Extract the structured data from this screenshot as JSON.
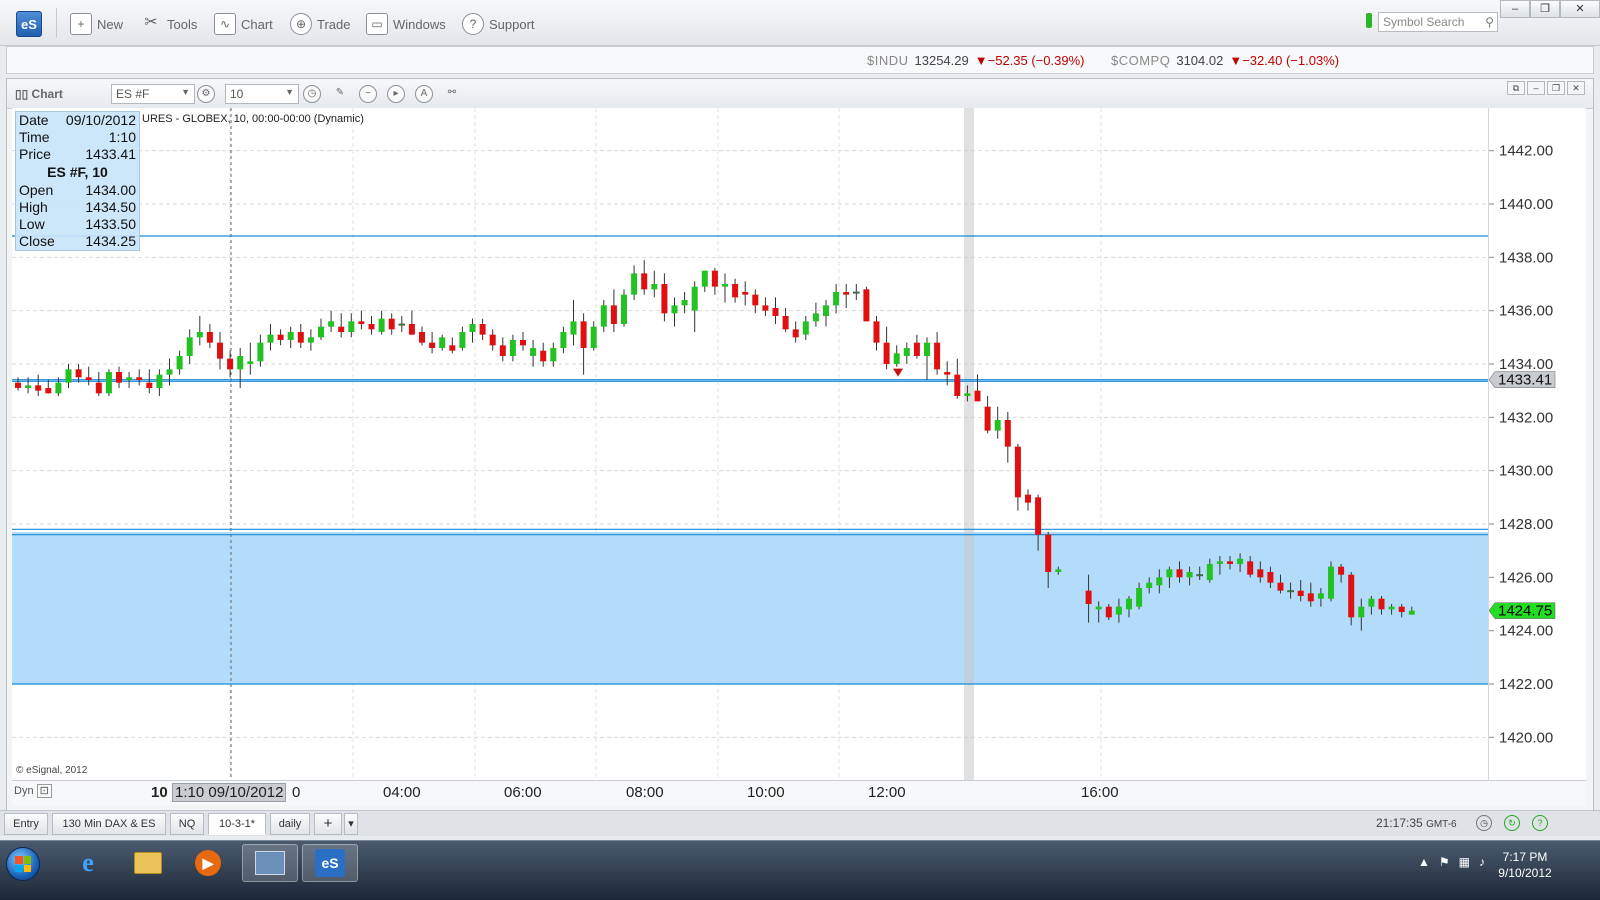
{
  "toolbar": {
    "logo": "eS",
    "items": [
      {
        "label": "New",
        "icon": "new-icon"
      },
      {
        "label": "Tools",
        "icon": "tools-icon"
      },
      {
        "label": "Chart",
        "icon": "chart-icon"
      },
      {
        "label": "Trade",
        "icon": "trade-icon"
      },
      {
        "label": "Windows",
        "icon": "windows-icon"
      },
      {
        "label": "Support",
        "icon": "help-icon"
      }
    ],
    "search_placeholder": "Symbol Search"
  },
  "ticker": [
    {
      "symbol": "$INDU",
      "value": "13254.29",
      "change": "▼−52.35 (−0.39%)"
    },
    {
      "symbol": "$COMPQ",
      "value": "3104.02",
      "change": "▼−32.40 (−1.03%)"
    }
  ],
  "chart_window": {
    "title": "Chart",
    "symbol": "ES #F",
    "interval": "10",
    "info": "URES - GLOBEX, 10, 00:00-00:00 (Dynamic)",
    "copyright": "© eSignal, 2012",
    "dyn_label": "Dyn"
  },
  "data_window": {
    "date_label": "Date",
    "date": "09/10/2012",
    "time_label": "Time",
    "time": "1:10",
    "price_label": "Price",
    "price": "1433.41",
    "title": "ES #F, 10",
    "open_label": "Open",
    "open": "1434.00",
    "high_label": "High",
    "high": "1434.50",
    "low_label": "Low",
    "low": "1433.50",
    "close_label": "Close",
    "close": "1434.25"
  },
  "x_labels": {
    "day": "10",
    "cursor": "1:10 09/10/2012",
    "partial": "0"
  },
  "tabs": [
    "Entry",
    "130 Min DAX & ES",
    "NQ",
    "10-3-1*",
    "daily"
  ],
  "tab_add": "+",
  "tab_menu": "▾",
  "status": {
    "time": "21:17:35",
    "tz": "GMT-6"
  },
  "taskbar": {
    "clock_time": "7:17 PM",
    "clock_date": "9/10/2012",
    "active_app": "eS"
  },
  "colors": {
    "up": "#22c222",
    "down": "#e01010",
    "zone": "#b3dcfa",
    "line": "#1a8ad8",
    "current_price": "#22dd22"
  },
  "chart_data": {
    "type": "candlestick",
    "ylim": [
      1418.4,
      1443.6
    ],
    "yticks": [
      "1442.00",
      "1440.00",
      "1438.00",
      "1436.00",
      "1434.00",
      "1432.00",
      "1430.00",
      "1428.00",
      "1426.00",
      "1424.00",
      "1422.00",
      "1420.00"
    ],
    "xticks": [
      "04:00",
      "06:00",
      "08:00",
      "10:00",
      "12:00",
      "16:00"
    ],
    "horizontal_lines": [
      1438.8,
      1433.41,
      1433.35,
      1427.8,
      1427.6,
      1422.0
    ],
    "zone": [
      1422.0,
      1427.7
    ],
    "cursor_price_label": "1433.41",
    "last_price_label": "1424.75",
    "last_price": 1424.75,
    "candles": [
      [
        1433.3,
        1433.5,
        1433.0,
        1433.1
      ],
      [
        1433.1,
        1433.5,
        1432.9,
        1433.2
      ],
      [
        1433.2,
        1433.6,
        1432.8,
        1433.0
      ],
      [
        1433.1,
        1433.4,
        1432.9,
        1432.9
      ],
      [
        1432.9,
        1433.5,
        1432.8,
        1433.3
      ],
      [
        1433.3,
        1434.0,
        1433.1,
        1433.8
      ],
      [
        1433.8,
        1434.0,
        1433.3,
        1433.5
      ],
      [
        1433.5,
        1433.9,
        1433.2,
        1433.4
      ],
      [
        1433.3,
        1433.7,
        1432.8,
        1432.9
      ],
      [
        1432.9,
        1433.8,
        1432.8,
        1433.7
      ],
      [
        1433.7,
        1433.9,
        1433.1,
        1433.3
      ],
      [
        1433.4,
        1433.7,
        1433.1,
        1433.5
      ],
      [
        1433.5,
        1433.8,
        1433.2,
        1433.4
      ],
      [
        1433.3,
        1433.8,
        1432.9,
        1433.1
      ],
      [
        1433.1,
        1433.8,
        1432.8,
        1433.6
      ],
      [
        1433.6,
        1434.2,
        1433.2,
        1433.8
      ],
      [
        1433.8,
        1434.5,
        1433.6,
        1434.3
      ],
      [
        1434.3,
        1435.3,
        1434.0,
        1435.0
      ],
      [
        1435.0,
        1435.8,
        1434.7,
        1435.2
      ],
      [
        1435.2,
        1435.5,
        1434.6,
        1434.8
      ],
      [
        1434.8,
        1435.2,
        1433.8,
        1434.2
      ],
      [
        1434.2,
        1434.5,
        1433.5,
        1433.8
      ],
      [
        1433.8,
        1434.6,
        1433.1,
        1434.3
      ],
      [
        1434.0,
        1434.8,
        1433.6,
        1434.1
      ],
      [
        1434.1,
        1435.1,
        1433.9,
        1434.8
      ],
      [
        1434.8,
        1435.5,
        1434.5,
        1435.1
      ],
      [
        1435.1,
        1435.3,
        1434.7,
        1434.9
      ],
      [
        1434.9,
        1435.4,
        1434.6,
        1435.2
      ],
      [
        1435.2,
        1435.5,
        1434.6,
        1434.8
      ],
      [
        1434.8,
        1435.3,
        1434.5,
        1435.0
      ],
      [
        1435.0,
        1435.7,
        1434.9,
        1435.4
      ],
      [
        1435.4,
        1436.0,
        1435.2,
        1435.6
      ],
      [
        1435.4,
        1435.9,
        1435.0,
        1435.2
      ],
      [
        1435.2,
        1435.9,
        1435.0,
        1435.6
      ],
      [
        1435.6,
        1436.0,
        1435.3,
        1435.5
      ],
      [
        1435.5,
        1435.8,
        1435.1,
        1435.3
      ],
      [
        1435.2,
        1436.0,
        1435.1,
        1435.7
      ],
      [
        1435.7,
        1435.9,
        1435.1,
        1435.3
      ],
      [
        1435.5,
        1435.8,
        1435.2,
        1435.5
      ],
      [
        1435.5,
        1436.0,
        1435.1,
        1435.1
      ],
      [
        1435.2,
        1435.4,
        1434.7,
        1434.8
      ],
      [
        1434.8,
        1435.2,
        1434.4,
        1434.6
      ],
      [
        1434.6,
        1435.1,
        1434.5,
        1435.0
      ],
      [
        1434.7,
        1435.0,
        1434.4,
        1434.5
      ],
      [
        1434.6,
        1435.4,
        1434.5,
        1435.2
      ],
      [
        1435.2,
        1435.7,
        1434.8,
        1435.5
      ],
      [
        1435.5,
        1435.7,
        1434.9,
        1435.1
      ],
      [
        1435.1,
        1435.3,
        1434.5,
        1434.7
      ],
      [
        1434.7,
        1435.0,
        1434.1,
        1434.3
      ],
      [
        1434.3,
        1435.1,
        1434.1,
        1434.9
      ],
      [
        1434.9,
        1435.2,
        1434.5,
        1434.7
      ],
      [
        1434.3,
        1434.9,
        1433.9,
        1434.6
      ],
      [
        1434.5,
        1434.8,
        1433.9,
        1434.1
      ],
      [
        1434.1,
        1434.8,
        1433.9,
        1434.6
      ],
      [
        1434.6,
        1435.4,
        1434.4,
        1435.2
      ],
      [
        1435.1,
        1436.4,
        1434.7,
        1435.6
      ],
      [
        1435.6,
        1435.9,
        1433.6,
        1434.6
      ],
      [
        1434.6,
        1435.6,
        1434.5,
        1435.4
      ],
      [
        1435.4,
        1436.4,
        1435.2,
        1436.2
      ],
      [
        1436.2,
        1436.8,
        1435.2,
        1435.5
      ],
      [
        1435.5,
        1436.8,
        1435.4,
        1436.6
      ],
      [
        1436.6,
        1437.7,
        1436.4,
        1437.4
      ],
      [
        1437.4,
        1437.9,
        1436.6,
        1436.8
      ],
      [
        1436.8,
        1437.5,
        1436.5,
        1437.0
      ],
      [
        1437.0,
        1437.4,
        1435.6,
        1435.9
      ],
      [
        1435.9,
        1436.5,
        1435.4,
        1436.2
      ],
      [
        1436.2,
        1436.7,
        1435.9,
        1436.4
      ],
      [
        1436.0,
        1437.1,
        1435.2,
        1436.9
      ],
      [
        1436.9,
        1437.5,
        1436.7,
        1437.5
      ],
      [
        1437.5,
        1437.6,
        1436.6,
        1436.9
      ],
      [
        1436.9,
        1437.4,
        1436.3,
        1437.0
      ],
      [
        1437.0,
        1437.2,
        1436.3,
        1436.5
      ],
      [
        1436.7,
        1437.1,
        1436.2,
        1436.6
      ],
      [
        1436.6,
        1436.8,
        1435.9,
        1436.2
      ],
      [
        1436.2,
        1436.5,
        1435.8,
        1436.0
      ],
      [
        1436.1,
        1436.5,
        1435.5,
        1435.8
      ],
      [
        1435.8,
        1436.1,
        1435.2,
        1435.3
      ],
      [
        1435.3,
        1435.6,
        1434.8,
        1435.0
      ],
      [
        1435.1,
        1435.8,
        1434.9,
        1435.6
      ],
      [
        1435.6,
        1436.3,
        1435.4,
        1435.9
      ],
      [
        1435.8,
        1436.4,
        1435.4,
        1436.2
      ],
      [
        1436.2,
        1437.0,
        1435.9,
        1436.7
      ],
      [
        1436.7,
        1437.0,
        1436.1,
        1436.6
      ],
      [
        1436.7,
        1437.0,
        1436.4,
        1436.7
      ],
      [
        1436.8,
        1436.9,
        1435.6,
        1435.6
      ],
      [
        1435.6,
        1435.8,
        1434.5,
        1434.8
      ],
      [
        1434.8,
        1435.4,
        1433.8,
        1434.0
      ],
      [
        1434.0,
        1434.7,
        1433.9,
        1434.4
      ],
      [
        1434.3,
        1434.8,
        1434.0,
        1434.6
      ],
      [
        1434.8,
        1435.1,
        1434.2,
        1434.3
      ],
      [
        1434.3,
        1435.0,
        1433.4,
        1434.8
      ],
      [
        1434.8,
        1435.2,
        1433.6,
        1433.8
      ],
      [
        1433.7,
        1434.1,
        1433.2,
        1433.6
      ],
      [
        1433.6,
        1434.2,
        1432.7,
        1432.8
      ],
      [
        1432.8,
        1433.2,
        1432.6,
        1432.9
      ],
      [
        1433.0,
        1433.6,
        1432.6,
        1432.6
      ],
      [
        1432.4,
        1432.8,
        1431.4,
        1431.5
      ],
      [
        1431.5,
        1432.4,
        1431.2,
        1431.9
      ],
      [
        1431.9,
        1432.2,
        1430.3,
        1430.9
      ],
      [
        1430.9,
        1431.0,
        1428.5,
        1429.0
      ],
      [
        1429.1,
        1429.3,
        1428.5,
        1428.8
      ],
      [
        1429.0,
        1429.1,
        1427.0,
        1427.6
      ],
      [
        1427.6,
        1427.7,
        1425.6,
        1426.2
      ],
      [
        1426.2,
        1426.4,
        1426.1,
        1426.3
      ],
      null,
      null,
      [
        1425.5,
        1426.1,
        1424.3,
        1425.0
      ],
      [
        1424.8,
        1425.1,
        1424.3,
        1424.9
      ],
      [
        1424.9,
        1425.0,
        1424.4,
        1424.5
      ],
      [
        1424.6,
        1425.2,
        1424.3,
        1424.9
      ],
      [
        1424.8,
        1425.3,
        1424.5,
        1425.2
      ],
      [
        1424.9,
        1425.8,
        1424.8,
        1425.6
      ],
      [
        1425.6,
        1426.0,
        1425.4,
        1425.8
      ],
      [
        1425.7,
        1426.3,
        1425.4,
        1426.0
      ],
      [
        1426.0,
        1426.4,
        1425.6,
        1426.3
      ],
      [
        1426.3,
        1426.6,
        1425.8,
        1426.0
      ],
      [
        1426.0,
        1426.4,
        1425.7,
        1426.2
      ],
      [
        1426.1,
        1426.4,
        1425.9,
        1426.1
      ],
      [
        1425.9,
        1426.7,
        1425.8,
        1426.5
      ],
      [
        1426.5,
        1426.8,
        1426.1,
        1426.6
      ],
      [
        1426.6,
        1426.8,
        1426.3,
        1426.5
      ],
      [
        1426.5,
        1426.9,
        1426.2,
        1426.7
      ],
      [
        1426.6,
        1426.8,
        1426.0,
        1426.1
      ],
      [
        1426.3,
        1426.6,
        1425.8,
        1426.0
      ],
      [
        1426.2,
        1426.4,
        1425.6,
        1425.8
      ],
      [
        1425.8,
        1426.1,
        1425.4,
        1425.5
      ],
      [
        1425.5,
        1425.8,
        1425.2,
        1425.5
      ],
      [
        1425.5,
        1425.9,
        1425.1,
        1425.3
      ],
      [
        1425.4,
        1425.8,
        1424.9,
        1425.1
      ],
      [
        1425.2,
        1425.6,
        1424.9,
        1425.4
      ],
      [
        1425.2,
        1426.6,
        1425.1,
        1426.4
      ],
      [
        1426.4,
        1426.5,
        1425.8,
        1426.1
      ],
      [
        1426.1,
        1426.2,
        1424.2,
        1424.5
      ],
      [
        1424.5,
        1425.2,
        1424.0,
        1424.9
      ],
      [
        1424.9,
        1425.3,
        1424.6,
        1425.2
      ],
      [
        1425.2,
        1425.3,
        1424.6,
        1424.8
      ],
      [
        1424.8,
        1425.0,
        1424.6,
        1424.9
      ],
      [
        1424.9,
        1425.0,
        1424.5,
        1424.7
      ],
      [
        1424.6,
        1424.9,
        1424.6,
        1424.75
      ]
    ]
  }
}
